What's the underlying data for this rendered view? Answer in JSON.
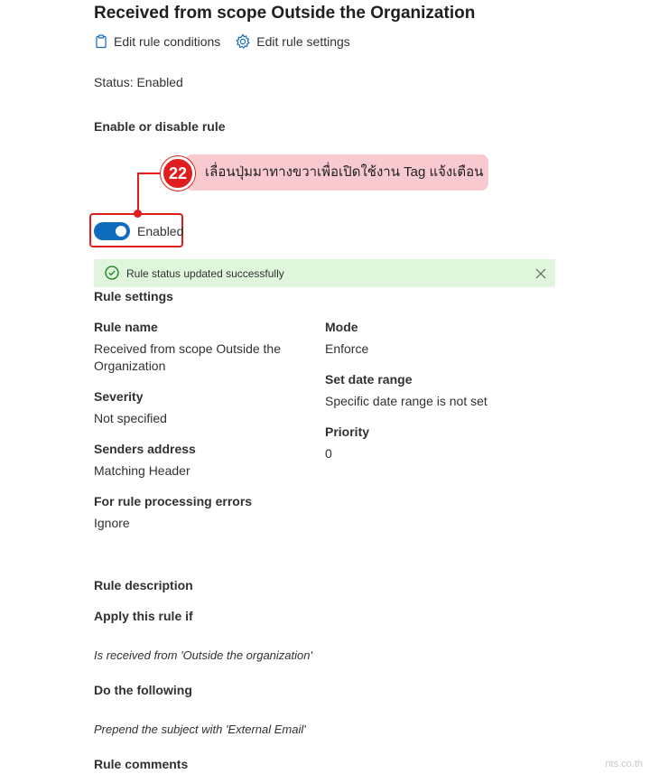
{
  "page": {
    "title": "Received from scope Outside the Organization"
  },
  "commands": {
    "edit_conditions": "Edit rule conditions",
    "edit_settings": "Edit rule settings"
  },
  "status": {
    "text": "Status: Enabled",
    "enable_label": "Enable or disable rule",
    "toggle_label": "Enabled",
    "toggle_on": true
  },
  "callout": {
    "number": "22",
    "text": "เลื่อนปุ่มมาทางขวาเพื่อเปิดใช้งาน Tag แจ้งเตือน"
  },
  "message_bar": {
    "text": "Rule status updated successfully"
  },
  "settings": {
    "heading": "Rule settings",
    "rule_name_label": "Rule name",
    "rule_name_value_1": "Received from scope Outside the",
    "rule_name_value_2": "Organization",
    "severity_label": "Severity",
    "severity_value": "Not specified",
    "senders_label": "Senders address",
    "senders_value": "Matching Header",
    "errors_label": "For rule processing errors",
    "errors_value": "Ignore",
    "mode_label": "Mode",
    "mode_value": "Enforce",
    "date_label": "Set date range",
    "date_value": "Specific date range is not set",
    "priority_label": "Priority",
    "priority_value": "0"
  },
  "description": {
    "heading": "Rule description",
    "apply_label": "Apply this rule if",
    "apply_value": "Is received from 'Outside the organization'",
    "do_label": "Do the following",
    "do_value": "Prepend the subject with 'External Email'",
    "comments_label": "Rule comments"
  },
  "watermark": "nts.co.th",
  "colors": {
    "accent": "#0f6cbd",
    "success_bg": "#dff6dd",
    "success_icon": "#107c10",
    "callout_red": "#e01e1e",
    "callout_bg": "#f8c9cf"
  }
}
